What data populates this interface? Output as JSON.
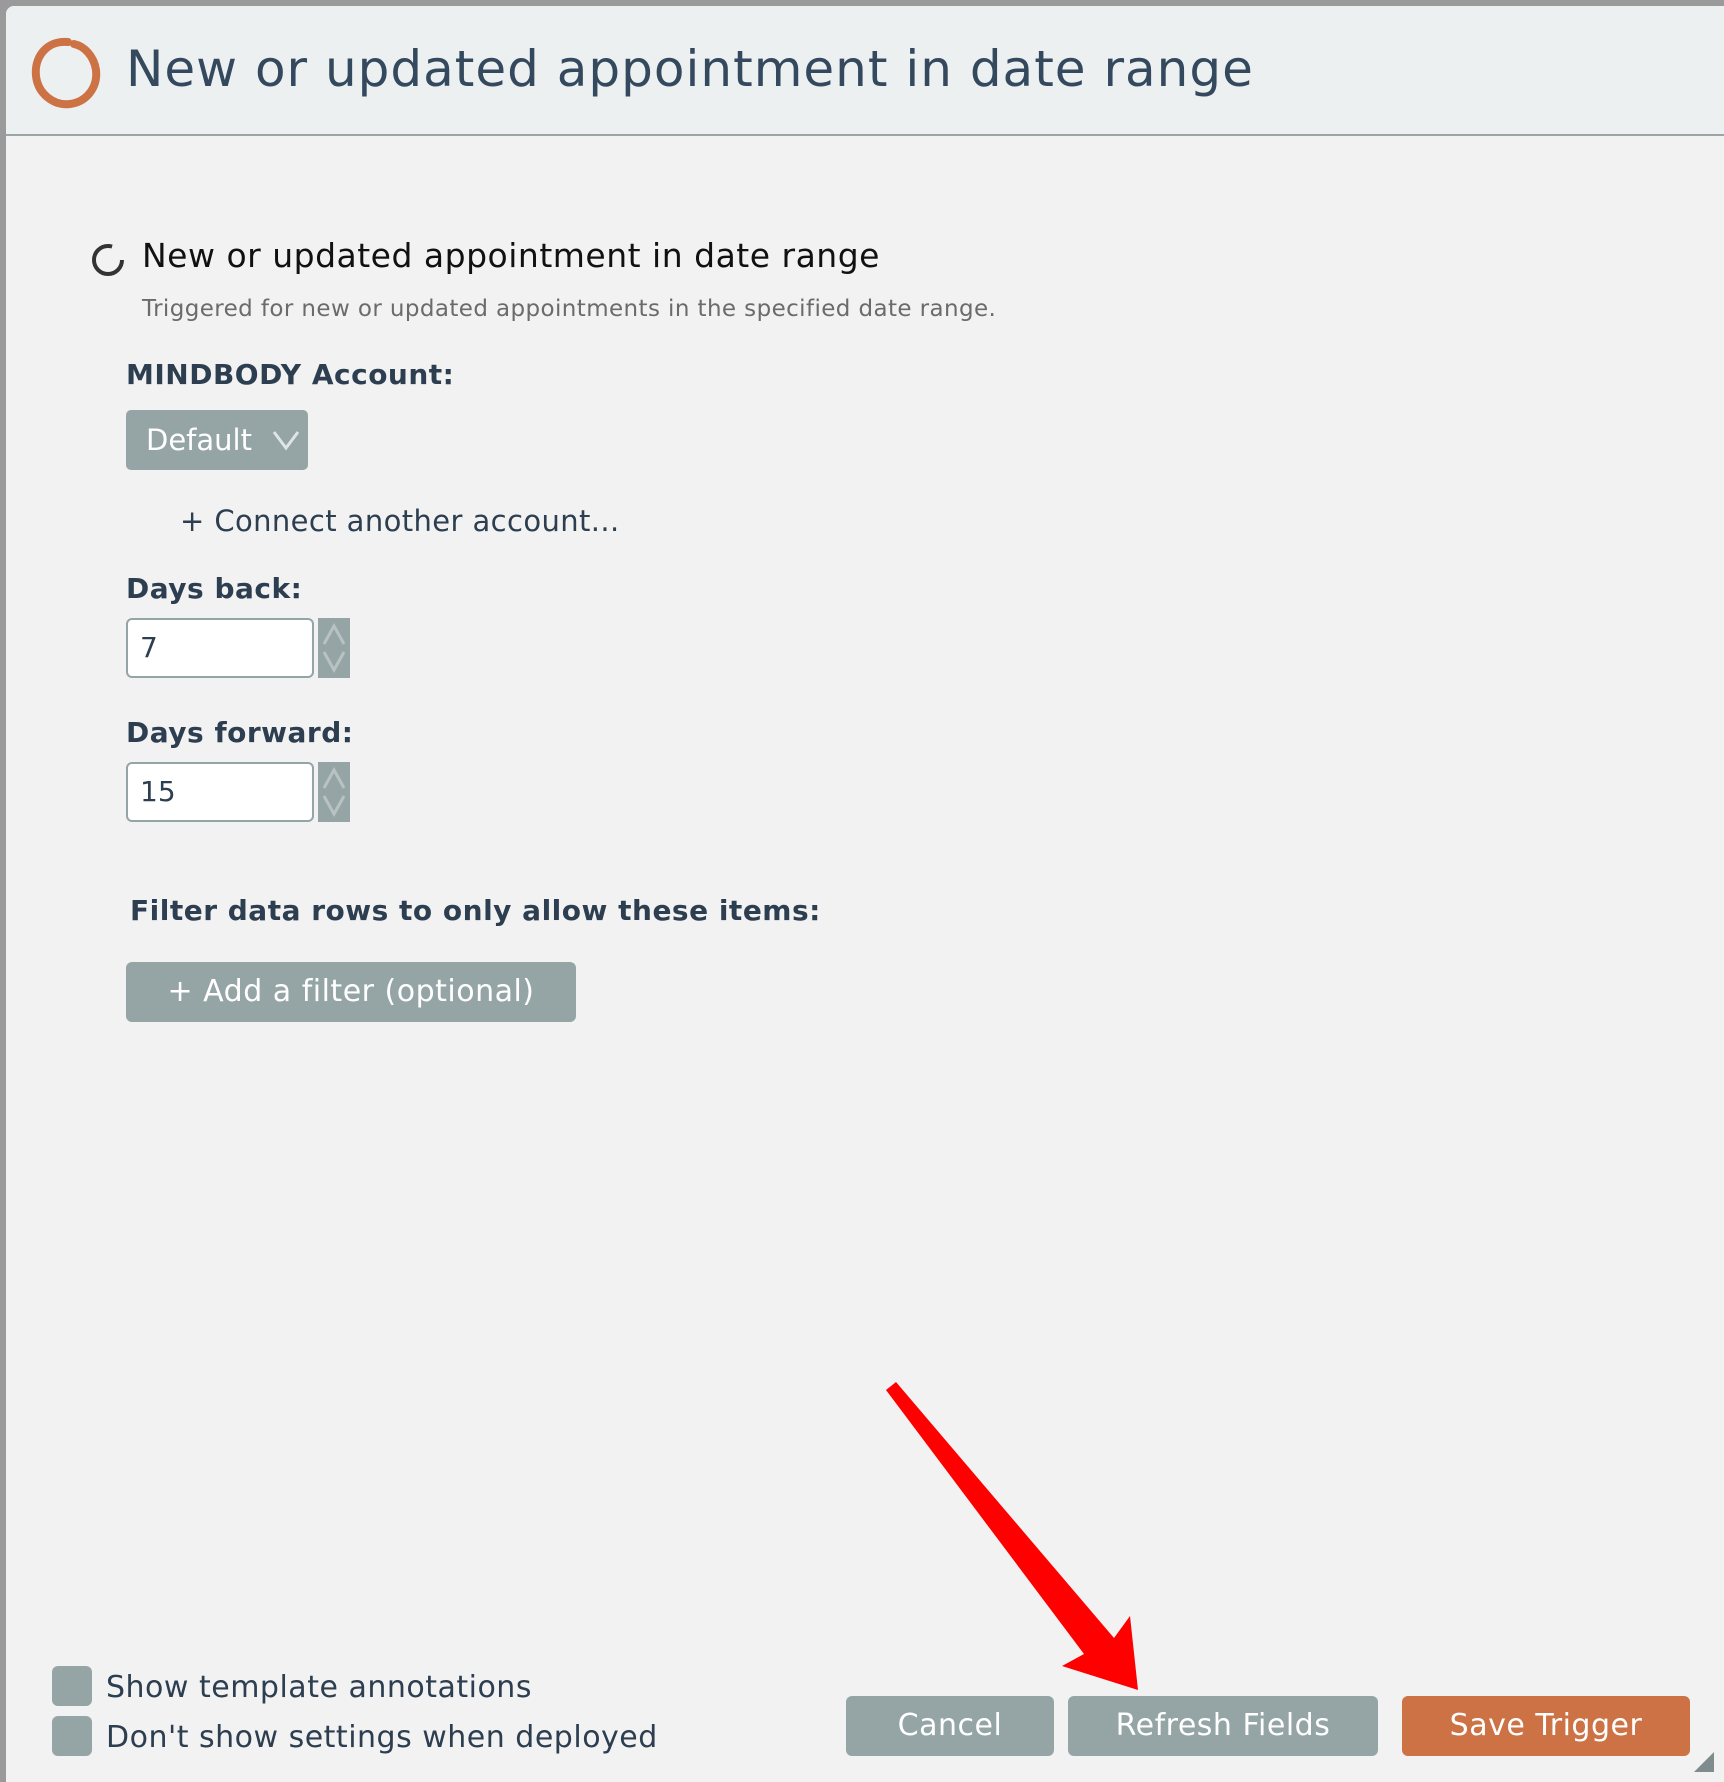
{
  "header": {
    "title": "New or updated appointment in date range",
    "logo_icon": "ring-logo-icon"
  },
  "trigger": {
    "name": "New or updated appointment in date range",
    "description": "Triggered for new or updated appointments in the specified date range."
  },
  "account": {
    "label": "MINDBODY Account:",
    "selected": "Default",
    "connect_link": "+ Connect another account..."
  },
  "days_back": {
    "label": "Days back:",
    "value": "7"
  },
  "days_forward": {
    "label": "Days forward:",
    "value": "15"
  },
  "filter": {
    "label": "Filter data rows to only allow these items:",
    "button": "+ Add a filter (optional)"
  },
  "options": {
    "show_annotations": "Show template annotations",
    "hide_settings": "Don't show settings when deployed"
  },
  "footer": {
    "cancel": "Cancel",
    "refresh": "Refresh Fields",
    "save": "Save Trigger"
  },
  "colors": {
    "accent": "#cd7244",
    "button_gray": "#95a5a6",
    "text_dark": "#2c3e50",
    "annotation_arrow": "#ff0000"
  }
}
